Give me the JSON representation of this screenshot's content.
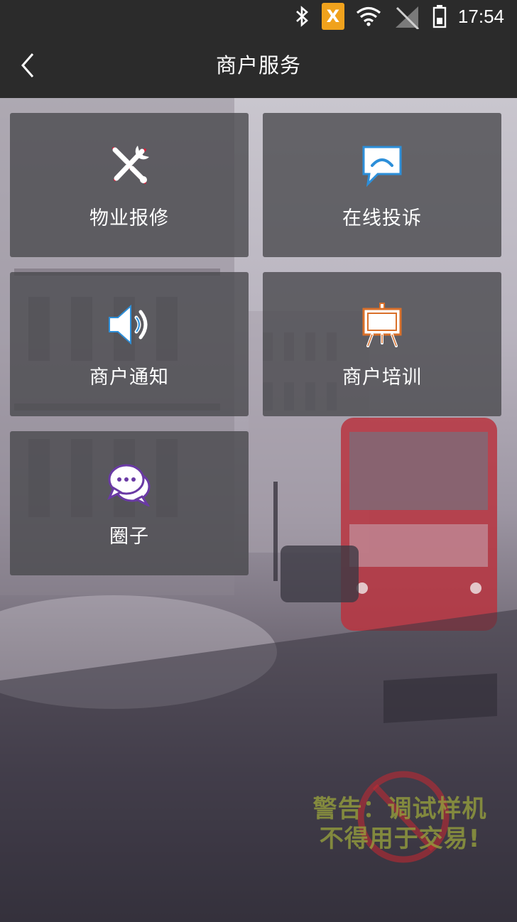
{
  "status_bar": {
    "time": "17:54",
    "sim_badge": "X",
    "icons": [
      "bluetooth-icon",
      "sim-x-icon",
      "wifi-icon",
      "signal-off-icon",
      "battery-icon"
    ]
  },
  "header": {
    "title": "商户服务",
    "back_icon": "chevron-left-icon"
  },
  "tiles": [
    {
      "label": "物业报修",
      "icon": "wrench-screwdriver-icon"
    },
    {
      "label": "在线投诉",
      "icon": "speech-bubble-icon"
    },
    {
      "label": "商户通知",
      "icon": "speaker-icon"
    },
    {
      "label": "商户培训",
      "icon": "easel-icon"
    },
    {
      "label": "圈子",
      "icon": "chat-bubbles-icon"
    }
  ],
  "watermark": {
    "line1": "警告：调试样机",
    "line2": "不得用于交易!"
  },
  "colors": {
    "bar_bg": "#2b2b2b",
    "tile_bg": "rgba(72,72,76,0.78)",
    "accent_red": "#d0223a",
    "accent_blue": "#2d8fd9",
    "accent_purple": "#6a3aa5",
    "accent_orange": "#d9702a"
  }
}
